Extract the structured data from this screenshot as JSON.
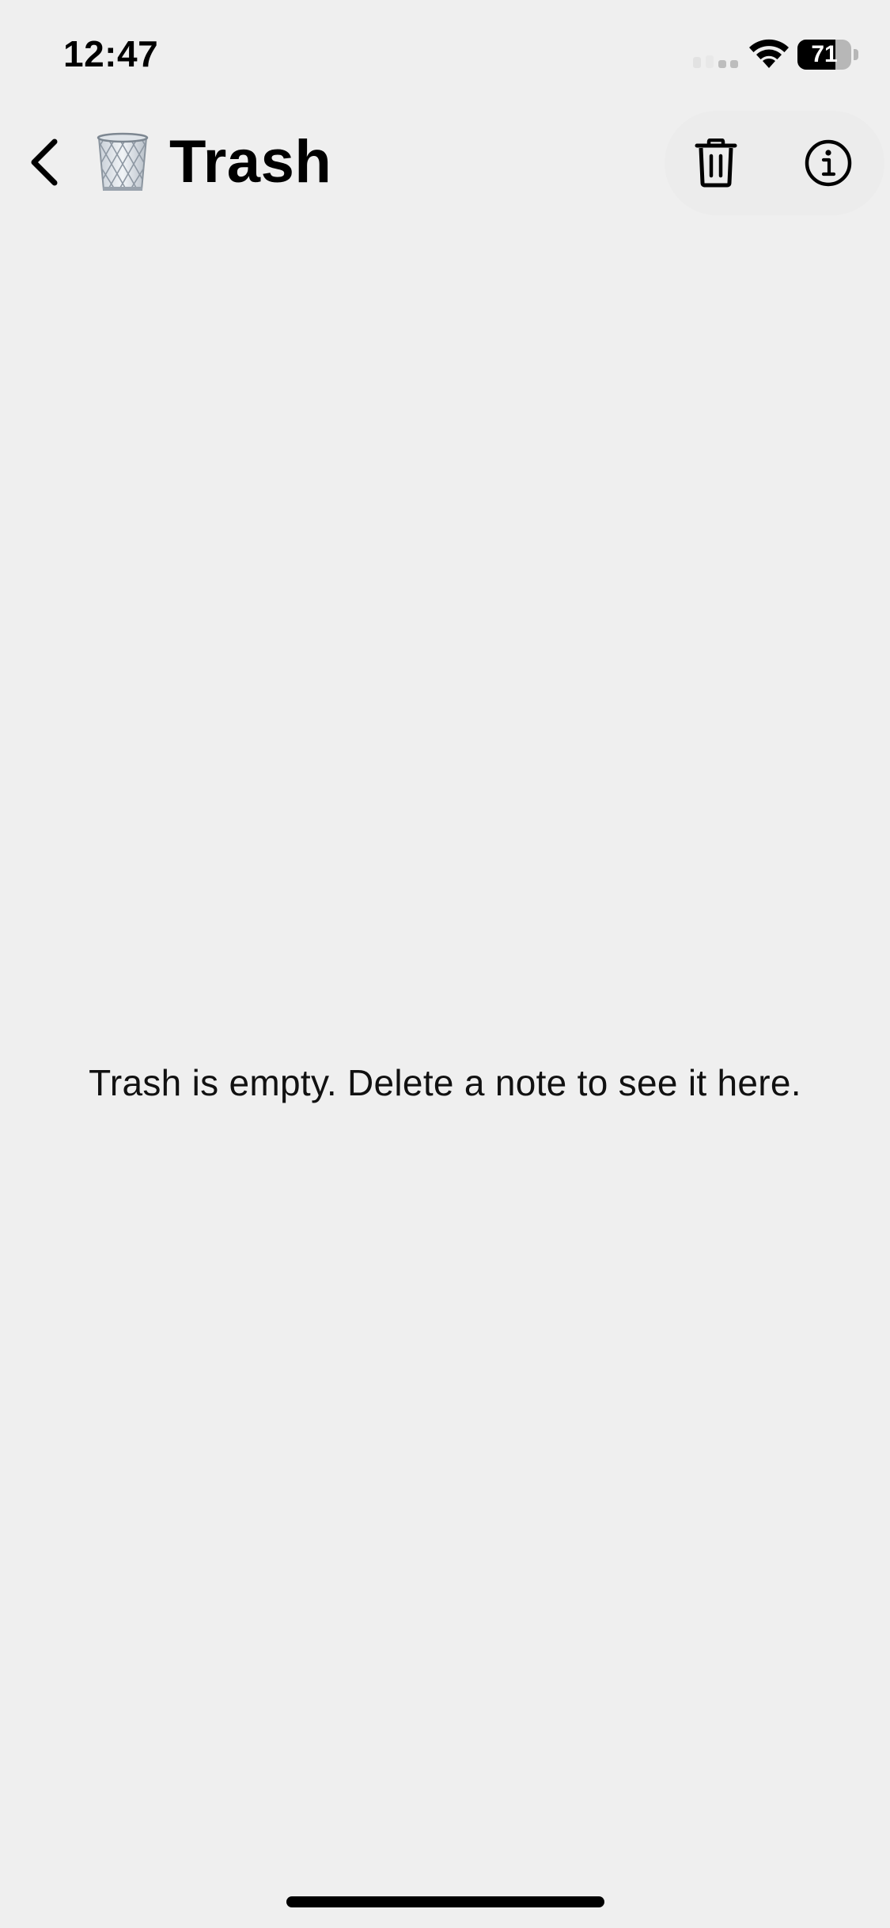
{
  "status_bar": {
    "time": "12:47",
    "battery_level": "71",
    "battery_fraction": 0.71
  },
  "header": {
    "back_icon": "chevron-left-icon",
    "title_icon": "wastebasket-icon",
    "title": "Trash",
    "actions": [
      {
        "name": "delete-all",
        "icon": "trash-icon"
      },
      {
        "name": "info",
        "icon": "info-circle-icon"
      }
    ]
  },
  "empty_state": {
    "message": "Trash is empty. Delete a note to see it here."
  },
  "colors": {
    "background": "#efefef",
    "text": "#000000"
  }
}
